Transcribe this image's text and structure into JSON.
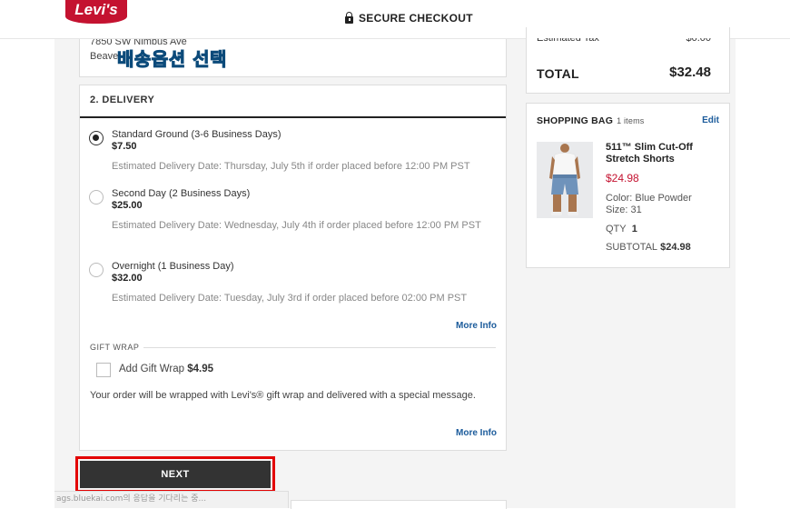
{
  "header": {
    "logo_text": "Levi's",
    "secure_label": "SECURE CHECKOUT"
  },
  "address": {
    "line1": "7850 SW Nimbus Ave",
    "line2": "Beave"
  },
  "overlay_text": "배송옵션 선택",
  "delivery": {
    "title": "2. DELIVERY",
    "options": [
      {
        "name": "Standard Ground (3-6 Business Days)",
        "price": "$7.50",
        "estimate": "Estimated Delivery Date: Thursday, July 5th if order placed before 12:00 PM PST",
        "selected": true
      },
      {
        "name": "Second Day (2 Business Days)",
        "price": "$25.00",
        "estimate": "Estimated Delivery Date: Wednesday, July 4th if order placed before 12:00 PM PST",
        "selected": false
      },
      {
        "name": "Overnight (1 Business Day)",
        "price": "$32.00",
        "estimate": "Estimated Delivery Date: Tuesday, July 3rd if order placed before 02:00 PM PST",
        "selected": false
      }
    ],
    "more_info": "More Info",
    "gift_wrap": {
      "section_label": "GIFT WRAP",
      "checkbox_label": "Add Gift Wrap",
      "price": "$4.95",
      "description": "Your order will be wrapped with Levi's® gift wrap and delivered with a special message.",
      "more_info": "More Info"
    },
    "next_label": "NEXT"
  },
  "status_bar": "ags.bluekai.com의 응답을 기다리는 중...",
  "summary": {
    "tax_label": "Estimated Tax",
    "tax_value": "$0.00",
    "total_label": "TOTAL",
    "total_value": "$32.48"
  },
  "bag": {
    "title": "SHOPPING BAG",
    "count": "1 items",
    "edit_label": "Edit",
    "product": {
      "name": "511™ Slim Cut-Off Stretch Shorts",
      "price": "$24.98",
      "color": "Color: Blue Powder",
      "size": "Size: 31",
      "qty_label": "QTY",
      "qty_value": "1",
      "subtotal_label": "SUBTOTAL",
      "subtotal_value": "$24.98"
    }
  },
  "colors": {
    "brand_red": "#c41230",
    "link_blue": "#1b5b9b",
    "annotation_red": "#e30000",
    "button_dark": "#333333"
  }
}
